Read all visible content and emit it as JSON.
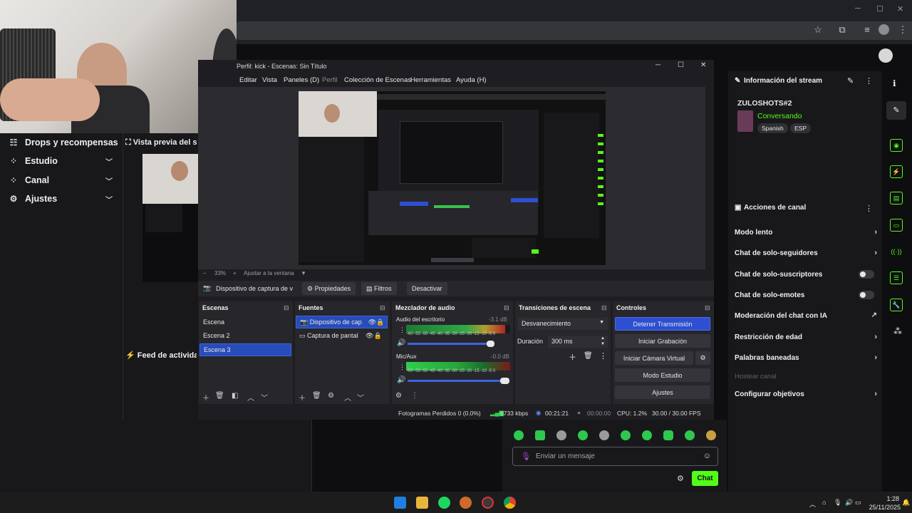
{
  "obs": {
    "title": "Perfil: kick - Escenas: Sin Título",
    "menu": [
      "Editar",
      "Vista",
      "Paneles (D)",
      "Perfil",
      "Colección de Escenas",
      "Herramientas",
      "Ayuda (H)"
    ],
    "zoom": "33%",
    "fit_label": "Ajustar a la ventana",
    "source_bar": {
      "source": "Dispositivo de captura de v",
      "properties": "Propiedades",
      "filters": "Filtros",
      "deactivate": "Desactivar"
    },
    "docks": {
      "scenes": {
        "title": "Escenas",
        "items": [
          "Escena",
          "Escena 2",
          "Escena 3"
        ],
        "selected": 2
      },
      "sources": {
        "title": "Fuentes",
        "items": [
          "Dispositivo de cap",
          "Captura de pantal"
        ]
      },
      "mixer": {
        "title": "Mezclador de audio",
        "channels": [
          {
            "name": "Audio del escritorio",
            "db": "-3.1 dB",
            "level": 0.95
          },
          {
            "name": "Mic/Aux",
            "db": "-0.0 dB",
            "level": 1.0
          }
        ],
        "scale": "-60 -55 -50 -45 -40 -35 -30 -25 -20 -15 -10 -5 0"
      },
      "transitions": {
        "title": "Transiciones de escena",
        "selected": "Desvanecimiento",
        "duration_label": "Duración",
        "duration_value": "300 ms"
      },
      "controls": {
        "title": "Controles",
        "buttons": [
          "Detener Transmisión",
          "Iniciar Grabación",
          "Iniciar Cámara Virtual",
          "Modo Estudio",
          "Ajustes"
        ]
      }
    },
    "status": {
      "dropped": "Fotogramas Perdidos 0 (0.0%)",
      "bitrate": "6733 kbps",
      "live_time": "00:21:21",
      "rec_time": "00:00:00",
      "cpu": "CPU: 1.2%",
      "fps": "30.00 / 30.00 FPS"
    }
  },
  "left_nav": {
    "items": [
      {
        "label": "Drops y recompensas",
        "icon": "gift-icon",
        "chevron": false
      },
      {
        "label": "Estudio",
        "icon": "studio-icon",
        "chevron": true
      },
      {
        "label": "Canal",
        "icon": "channel-icon",
        "chevron": true
      },
      {
        "label": "Ajustes",
        "icon": "gear-icon",
        "chevron": true
      }
    ]
  },
  "preview": {
    "title": "Vista previa del stream",
    "feed_title": "Feed de actividad"
  },
  "stream_info": {
    "title": "Información del stream",
    "username": "ZULOSHOTS#2",
    "category": "Conversando",
    "tags": [
      "Spanish",
      "ESP"
    ]
  },
  "channel_actions": {
    "title": "Acciones de canal",
    "items": [
      {
        "label": "Modo lento",
        "type": "chevron",
        "enabled": true
      },
      {
        "label": "Chat de solo-seguidores",
        "type": "chevron",
        "enabled": true
      },
      {
        "label": "Chat de solo-suscriptores",
        "type": "toggle",
        "enabled": true
      },
      {
        "label": "Chat de solo-emotes",
        "type": "toggle",
        "enabled": true
      },
      {
        "label": "Moderación del chat con IA",
        "type": "external",
        "enabled": true
      },
      {
        "label": "Restricción de edad",
        "type": "chevron",
        "enabled": true
      },
      {
        "label": "Palabras baneadas",
        "type": "chevron",
        "enabled": true
      },
      {
        "label": "Hostear canal",
        "type": "none",
        "enabled": false
      },
      {
        "label": "Configurar objetivos",
        "type": "chevron",
        "enabled": true
      }
    ]
  },
  "chat": {
    "placeholder": "Enviar un mensaje",
    "send_label": "Chat"
  },
  "taskbar": {
    "time": "1:28",
    "date": "25/11/2025"
  },
  "colors": {
    "accent": "#53fc18",
    "obs_selected": "#284cb8",
    "obs_stream_btn": "#2d4fd0"
  }
}
